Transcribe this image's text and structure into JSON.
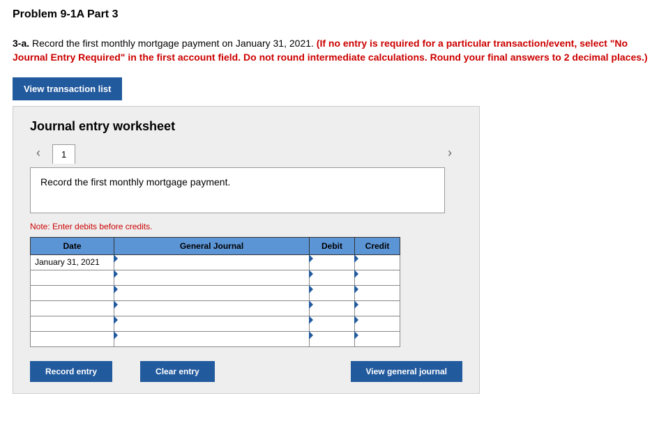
{
  "title": "Problem 9-1A Part 3",
  "question": {
    "label": "3-a.",
    "text": " Record the first monthly mortgage payment on January 31, 2021. ",
    "note": "(If no entry is required for a particular transaction/event, select \"No Journal Entry Required\" in the first account field. Do not round intermediate calculations. Round your final answers to 2 decimal places.)"
  },
  "buttons": {
    "view_list": "View transaction list",
    "record": "Record entry",
    "clear": "Clear entry",
    "view_journal": "View general journal"
  },
  "panel": {
    "heading": "Journal entry worksheet",
    "tab": "1",
    "description": "Record the first monthly mortgage payment.",
    "note": "Note: Enter debits before credits."
  },
  "table": {
    "headers": {
      "date": "Date",
      "journal": "General Journal",
      "debit": "Debit",
      "credit": "Credit"
    },
    "rows": [
      {
        "date": "January 31, 2021",
        "journal": "",
        "debit": "",
        "credit": ""
      },
      {
        "date": "",
        "journal": "",
        "debit": "",
        "credit": ""
      },
      {
        "date": "",
        "journal": "",
        "debit": "",
        "credit": ""
      },
      {
        "date": "",
        "journal": "",
        "debit": "",
        "credit": ""
      },
      {
        "date": "",
        "journal": "",
        "debit": "",
        "credit": ""
      },
      {
        "date": "",
        "journal": "",
        "debit": "",
        "credit": ""
      }
    ]
  }
}
